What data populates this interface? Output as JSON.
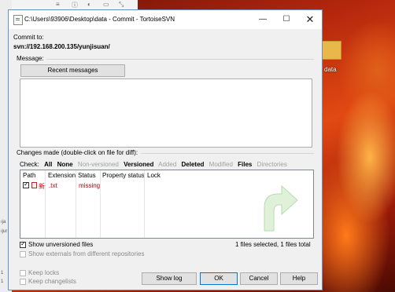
{
  "window": {
    "title": "C:\\Users\\93906\\Desktop\\data - Commit - TortoiseSVN",
    "minimize": "—",
    "maximize": "☐",
    "close": "✕"
  },
  "commit_to": {
    "label": "Commit to:",
    "url": "svn://192.168.200.135/yunjisuan/"
  },
  "message": {
    "label": "Message:",
    "recent_button": "Recent messages",
    "text": ""
  },
  "changes": {
    "label": "Changes made (double-click on file for diff):",
    "check_label": "Check:",
    "filters": {
      "all": "All",
      "none": "None",
      "non_versioned": "Non-versioned",
      "versioned": "Versioned",
      "added": "Added",
      "deleted": "Deleted",
      "modified": "Modified",
      "files": "Files",
      "directories": "Directories"
    },
    "columns": [
      "Path",
      "Extension",
      "Status",
      "Property status",
      "Lock"
    ],
    "rows": [
      {
        "path": "新",
        "extension": ".txt",
        "status": "missing",
        "checked": true
      }
    ]
  },
  "options": {
    "show_unversioned": "Show unversioned files",
    "show_externals": "Show externals from different repositories",
    "summary": "1 files selected, 1 files total",
    "keep_locks": "Keep locks",
    "keep_changelists": "Keep changelists"
  },
  "buttons": {
    "show_log": "Show log",
    "ok": "OK",
    "cancel": "Cancel",
    "help": "Help"
  },
  "desktop": {
    "icon_label": "data"
  },
  "colors": {
    "accent": "#0078d7",
    "status_missing": "#c00000"
  }
}
